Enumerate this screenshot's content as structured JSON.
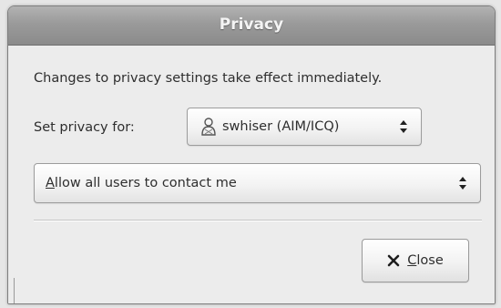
{
  "window": {
    "title": "Privacy"
  },
  "dialog": {
    "notice": "Changes to privacy settings take effect immediately.",
    "set_privacy_label": "Set privacy for:",
    "account_select": {
      "value": "swhiser (AIM/ICQ)",
      "icon": "person-icon"
    },
    "privacy_select": {
      "mnemonic": "A",
      "value_rest": "llow all users to contact me"
    },
    "close_button": {
      "mnemonic": "C",
      "label_rest": "lose",
      "icon": "close-icon"
    }
  },
  "colors": {
    "titlebar": "#9a9a9a",
    "dialog_bg": "#ececec",
    "text": "#2e2e2e"
  }
}
